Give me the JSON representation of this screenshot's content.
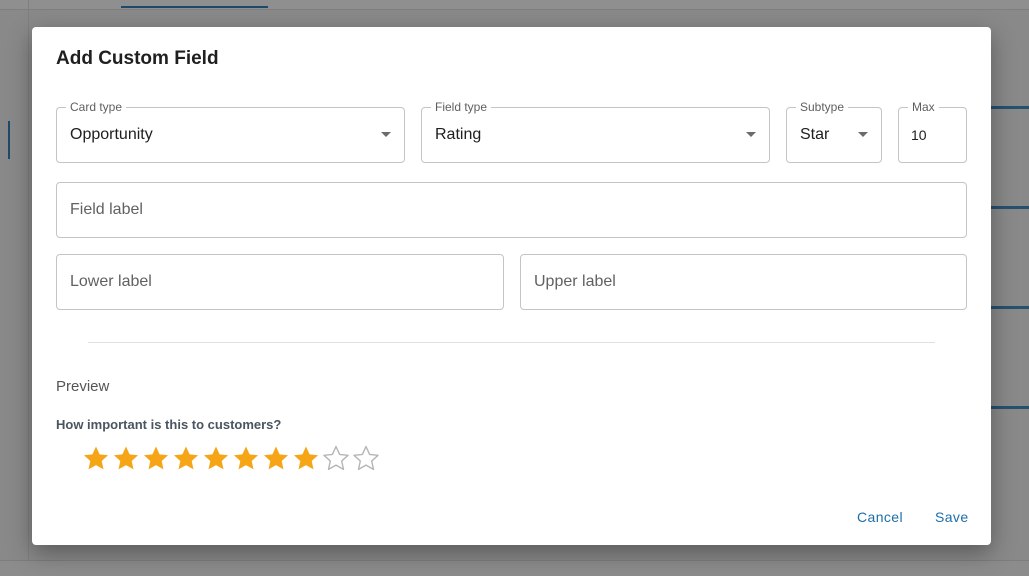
{
  "dialog": {
    "title": "Add Custom Field",
    "card_type": {
      "label": "Card type",
      "value": "Opportunity"
    },
    "field_type": {
      "label": "Field type",
      "value": "Rating"
    },
    "subtype": {
      "label": "Subtype",
      "value": "Star"
    },
    "max": {
      "label": "Max",
      "value": "10"
    },
    "field_label": {
      "placeholder": "Field label"
    },
    "lower_label": {
      "placeholder": "Lower label"
    },
    "upper_label": {
      "placeholder": "Upper label"
    },
    "preview": {
      "heading": "Preview",
      "question": "How important is this to customers?",
      "rating": {
        "filled": 8,
        "max": 10
      }
    },
    "actions": {
      "cancel": "Cancel",
      "save": "Save"
    }
  },
  "colors": {
    "accent": "#1e6fa8",
    "star_filled": "#f5a515",
    "star_empty": "#b5b5b5",
    "backdrop": "#898989"
  },
  "icons": {
    "dropdown": "caret-down-icon",
    "star_filled": "star-filled-icon",
    "star_empty": "star-outline-icon"
  }
}
